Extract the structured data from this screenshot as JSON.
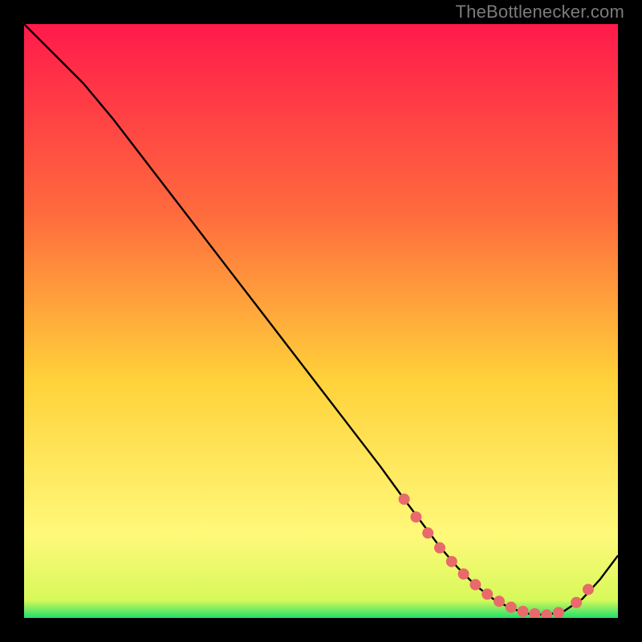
{
  "watermark": "TheBottlenecker.com",
  "colors": {
    "gradient_top": "#ff1a4b",
    "gradient_mid1": "#ff6b3d",
    "gradient_mid2": "#ffd23a",
    "gradient_mid3": "#fff97a",
    "gradient_bottom": "#22e06b",
    "curve": "#000000",
    "marker_fill": "#e86a6a",
    "marker_stroke": "#e86a6a",
    "background": "#000000"
  },
  "chart_data": {
    "type": "line",
    "title": "",
    "xlabel": "",
    "ylabel": "",
    "xlim": [
      0,
      100
    ],
    "ylim": [
      0,
      100
    ],
    "series": [
      {
        "name": "bottleneck-curve",
        "x": [
          0,
          3,
          6,
          10,
          15,
          20,
          25,
          30,
          35,
          40,
          45,
          50,
          55,
          60,
          64,
          67,
          70,
          73,
          76,
          79,
          82,
          85,
          88,
          91,
          94,
          97,
          100
        ],
        "y": [
          100,
          97,
          94,
          90,
          84,
          77.5,
          71,
          64.5,
          58,
          51.5,
          45,
          38.5,
          32,
          25.5,
          20,
          16,
          12,
          8.5,
          5.5,
          3.2,
          1.6,
          0.7,
          0.5,
          1.2,
          3.2,
          6.5,
          10.5
        ]
      }
    ],
    "markers": {
      "name": "highlight-points",
      "x": [
        64,
        66,
        68,
        70,
        72,
        74,
        76,
        78,
        80,
        82,
        84,
        86,
        88,
        90,
        93,
        95
      ],
      "y": [
        20,
        17,
        14.3,
        11.8,
        9.5,
        7.4,
        5.6,
        4,
        2.8,
        1.8,
        1.1,
        0.7,
        0.5,
        0.9,
        2.6,
        4.8
      ]
    }
  }
}
